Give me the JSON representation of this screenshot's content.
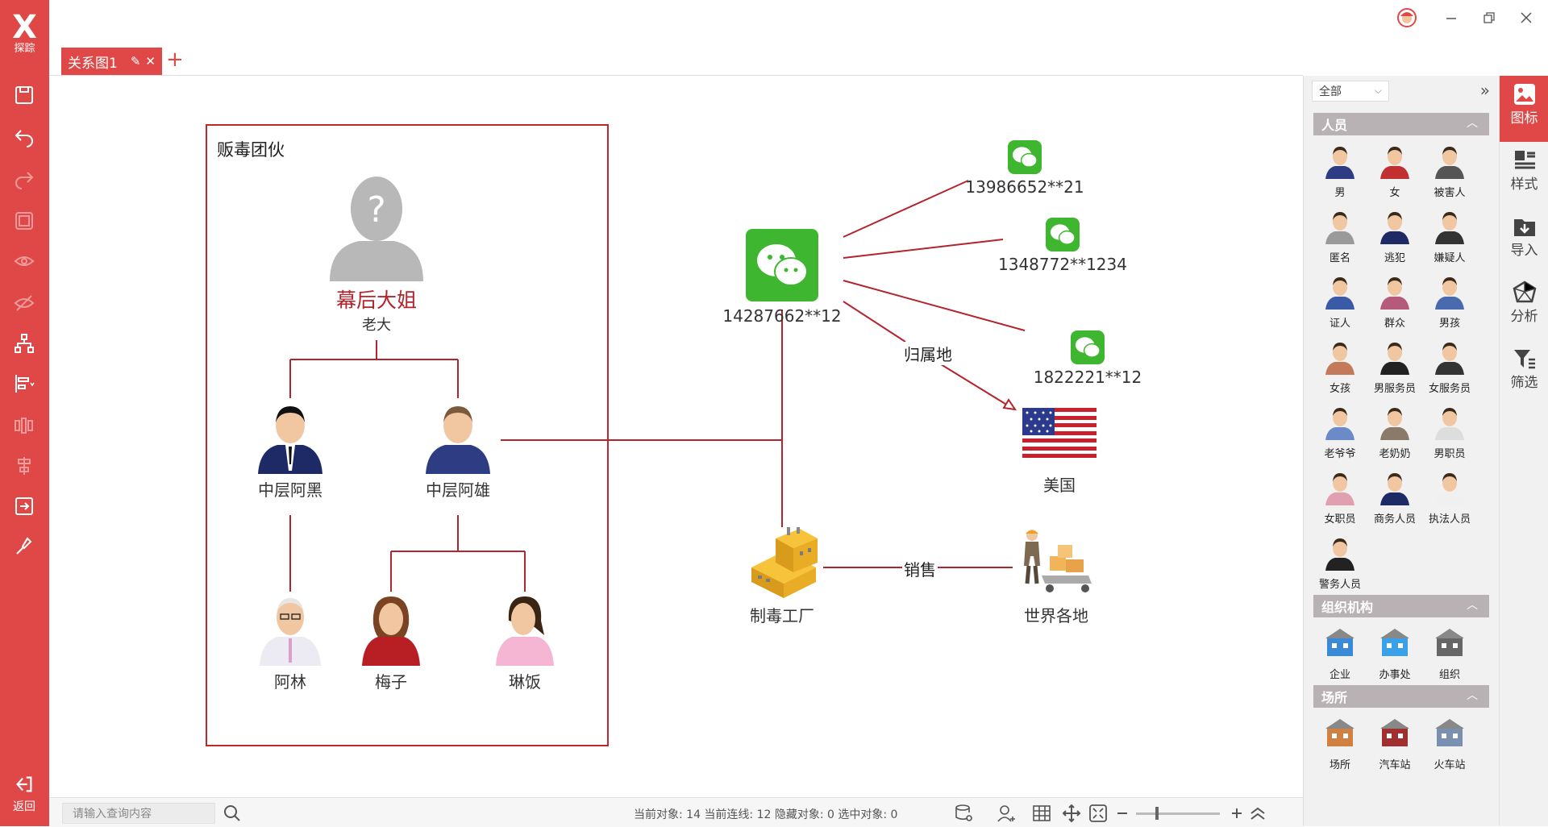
{
  "app": {
    "logo_text": "探踪",
    "back_label": "返回"
  },
  "tabs": [
    {
      "label": "关系图1"
    }
  ],
  "canvas": {
    "group_title": "贩毒团伙",
    "boss": {
      "name": "幕后大姐",
      "role": "老大"
    },
    "mid_left": "中层阿黑",
    "mid_right": "中层阿雄",
    "lin": "阿林",
    "meizi": "梅子",
    "linfan": "琳饭",
    "wechat_main": "14287662**12",
    "wechat_a": "13986652**21",
    "wechat_b": "1348772**1234",
    "wechat_c": "1822221**12",
    "usa": "美国",
    "factory": "制毒工厂",
    "world": "世界各地",
    "edge_belong": "归属地",
    "edge_sell": "销售"
  },
  "right_panel": {
    "filter": "全部",
    "sections": [
      {
        "title": "人员",
        "items": [
          "男",
          "女",
          "被害人",
          "匿名",
          "逃犯",
          "嫌疑人",
          "证人",
          "群众",
          "男孩",
          "女孩",
          "男服务员",
          "女服务员",
          "老爷爷",
          "老奶奶",
          "男职员",
          "女职员",
          "商务人员",
          "执法人员",
          "警务人员"
        ]
      },
      {
        "title": "组织机构",
        "items": [
          "企业",
          "办事处",
          "组织"
        ]
      },
      {
        "title": "场所",
        "items": [
          "场所",
          "汽车站",
          "火车站"
        ]
      }
    ]
  },
  "right_bar": [
    {
      "label": "图标",
      "icon": "image-icon",
      "active": true
    },
    {
      "label": "样式",
      "icon": "style-icon"
    },
    {
      "label": "导入",
      "icon": "import-icon"
    },
    {
      "label": "分析",
      "icon": "analyze-icon"
    },
    {
      "label": "筛选",
      "icon": "filter-icon"
    }
  ],
  "status": {
    "search_placeholder": "请输入查询内容",
    "stats": "当前对象: 14  当前连线: 12  隐藏对象: 0  选中对象: 0"
  },
  "colors": {
    "accent": "#e04848",
    "edge": "#b3242c",
    "wechat": "#3fb62f"
  }
}
